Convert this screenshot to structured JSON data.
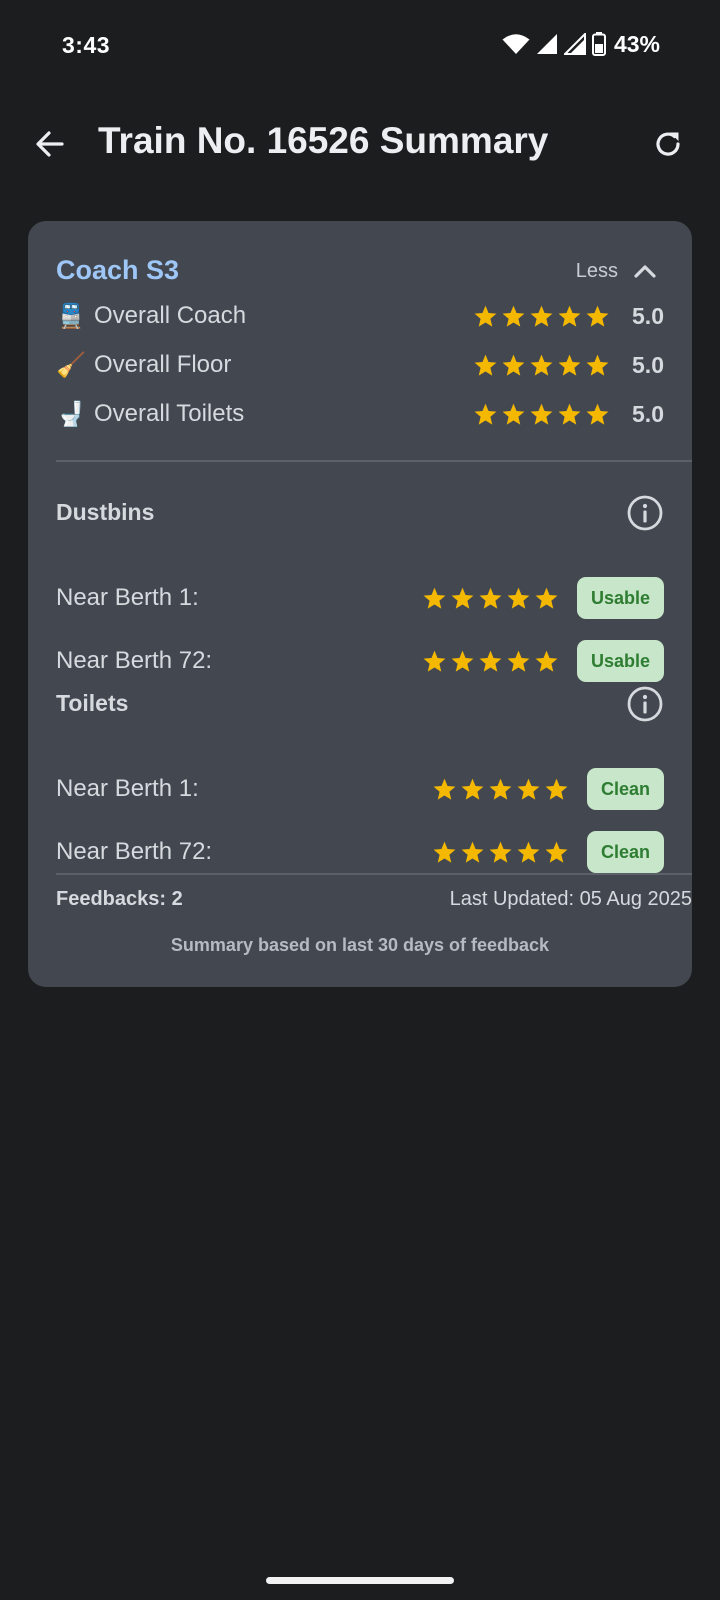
{
  "status_bar": {
    "time": "3:43",
    "battery": "43%",
    "icons": [
      "wifi-icon",
      "signal-icon",
      "signal-icon",
      "battery-icon"
    ]
  },
  "app_bar": {
    "title": "Train No. 16526 Summary",
    "back_icon": "arrow-left-icon",
    "refresh_icon": "refresh-icon"
  },
  "card": {
    "coach_title": "Coach S3",
    "toggle_label": "Less",
    "toggle_icon": "chevron-up-icon",
    "overall": [
      {
        "icon": "🚆",
        "label": "Overall Coach",
        "rating": 5,
        "value": "5.0"
      },
      {
        "icon": "🧹",
        "label": "Overall Floor",
        "rating": 5,
        "value": "5.0"
      },
      {
        "icon": "🚽",
        "label": "Overall Toilets",
        "rating": 5,
        "value": "5.0"
      }
    ],
    "dustbins": {
      "title": "Dustbins",
      "rows": [
        {
          "label": "Near Berth 1:",
          "rating": 5,
          "status": "Usable"
        },
        {
          "label": "Near Berth 72:",
          "rating": 5,
          "status": "Usable"
        }
      ]
    },
    "toilets": {
      "title": "Toilets",
      "rows": [
        {
          "label": "Near Berth 1:",
          "rating": 5,
          "status": "Clean"
        },
        {
          "label": "Near Berth 72:",
          "rating": 5,
          "status": "Clean"
        }
      ]
    },
    "feedbacks": "Feedbacks: 2",
    "last_updated": "Last Updated: 05 Aug 2025",
    "summary_note": "Summary based on last 30 days of feedback"
  },
  "colors": {
    "background": "#1c1d1f",
    "card": "#434850",
    "accent": "#9ec7f7",
    "star": "#f5b800",
    "badge_bg": "#c8e6c9",
    "badge_text": "#2e7d32"
  }
}
